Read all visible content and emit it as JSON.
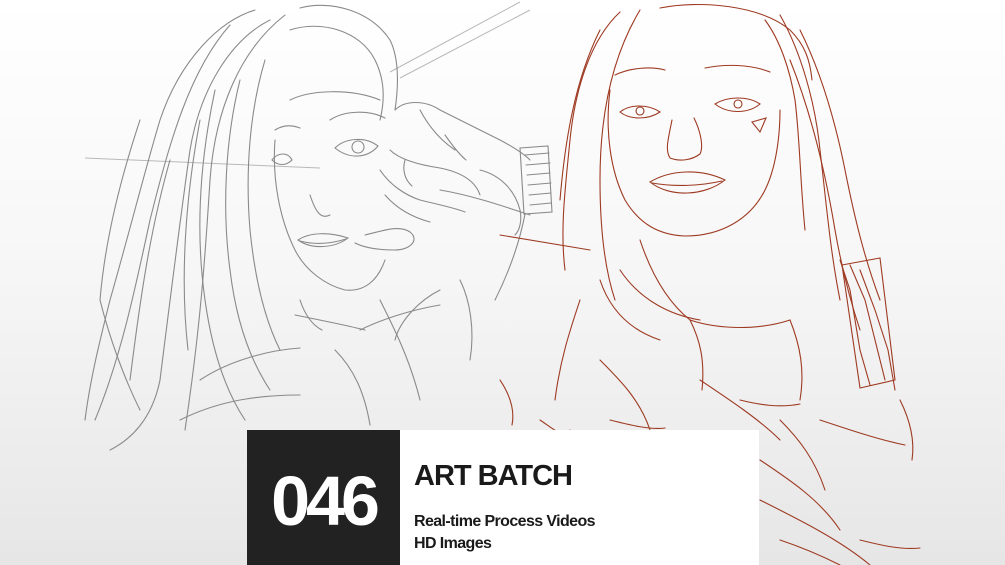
{
  "banner": {
    "number": "046",
    "title": "ART BATCH",
    "features": [
      "Real-time Process Videos",
      "HD Images"
    ]
  },
  "artwork": {
    "left_sketch": {
      "subject": "girl-posing-hand-near-eye",
      "line_color": "#8a8a8a"
    },
    "right_sketch": {
      "subject": "girl-looking-down",
      "line_color": "#9e3a22"
    }
  },
  "colors": {
    "banner_dark": "#222222",
    "banner_light": "#ffffff",
    "text_dark": "#1a1a1a"
  }
}
